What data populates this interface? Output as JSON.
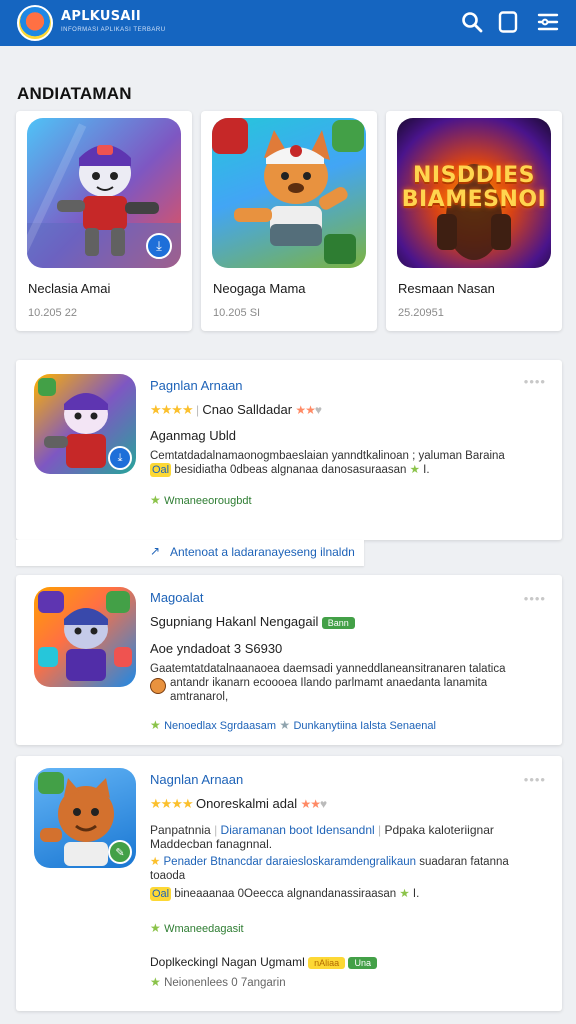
{
  "header": {
    "brand": "APLKUSAII",
    "brand_sub": "INFORMASI APLIKASI TERBARU",
    "icons": [
      "search-icon",
      "square-icon",
      "menu-filter-icon"
    ]
  },
  "section_title": "ANDIATAMAN",
  "featured": [
    {
      "name": "Neclasia Amai",
      "meta": "10.205 22"
    },
    {
      "name": "Neogaga Mama",
      "meta": "10.205 SI"
    },
    {
      "name": "Resmaan Nasan",
      "meta": "25.20951",
      "art_text": "NISDDIES BIAMESNOI"
    }
  ],
  "list": [
    {
      "title": "Pagnlan Arnaan",
      "rating_text": "Cnao Salldadar",
      "subtitle": "Aganmag Ubld",
      "body1": "Cemtatdadalnamaonogmbaeslaian yanndtkalinoan ; yaluman Baraina",
      "body2_prefix": "Oal",
      "body2": "besidiatha 0dbeas algnanaa danosasuraasan",
      "body2_suffix": "I.",
      "green": "Wmaneeorougbdt",
      "link": "Antenoat a ladaranayeseng ilnaldn"
    },
    {
      "title": "Magoalat",
      "subtitle": "Sgupniang Hakanl Nengagail",
      "pill": "Bann",
      "line2": "Aoe yndadoat 3 S6930",
      "body1": "Gaatemtatdatalnaanaoea daemsadi yanneddlaneansitranaren talatica",
      "body2": "antandr ikanarn ecoooea Ilando parlmamt anaedanta lanamita",
      "body3": "amtranarol,",
      "green1": "Nenoedlax Sgrdaasam",
      "green2": "Dunkanytiina Ialsta Senaenal"
    },
    {
      "title": "Nagnlan Arnaan",
      "rating_text": "Onoreskalmi adal",
      "line1_prefix": "Panpatnnia",
      "line1_link": "Diaramanan boot Idensandnl",
      "line1_suffix": "Pdpaka kaloteriignar",
      "line1b": "Maddecban fanagnnal.",
      "line2_link": "Penader Btnancdar daraiesloskaramdengralikaun",
      "line2_suffix": "suadaran fatanna",
      "line2b": "toaoda",
      "line3_prefix": "Oal",
      "line3": "bineaaanaa 0Oeecca algnandanassiraasan",
      "line3_suffix": "I.",
      "green": "Wmaneedagasit",
      "footer_label": "Doplkeckingl Nagan Ugmaml",
      "footer_pill1": "nAliaa",
      "footer_pill2": "Una",
      "footer_meta": "Neionenlees 0 7angarin"
    }
  ]
}
